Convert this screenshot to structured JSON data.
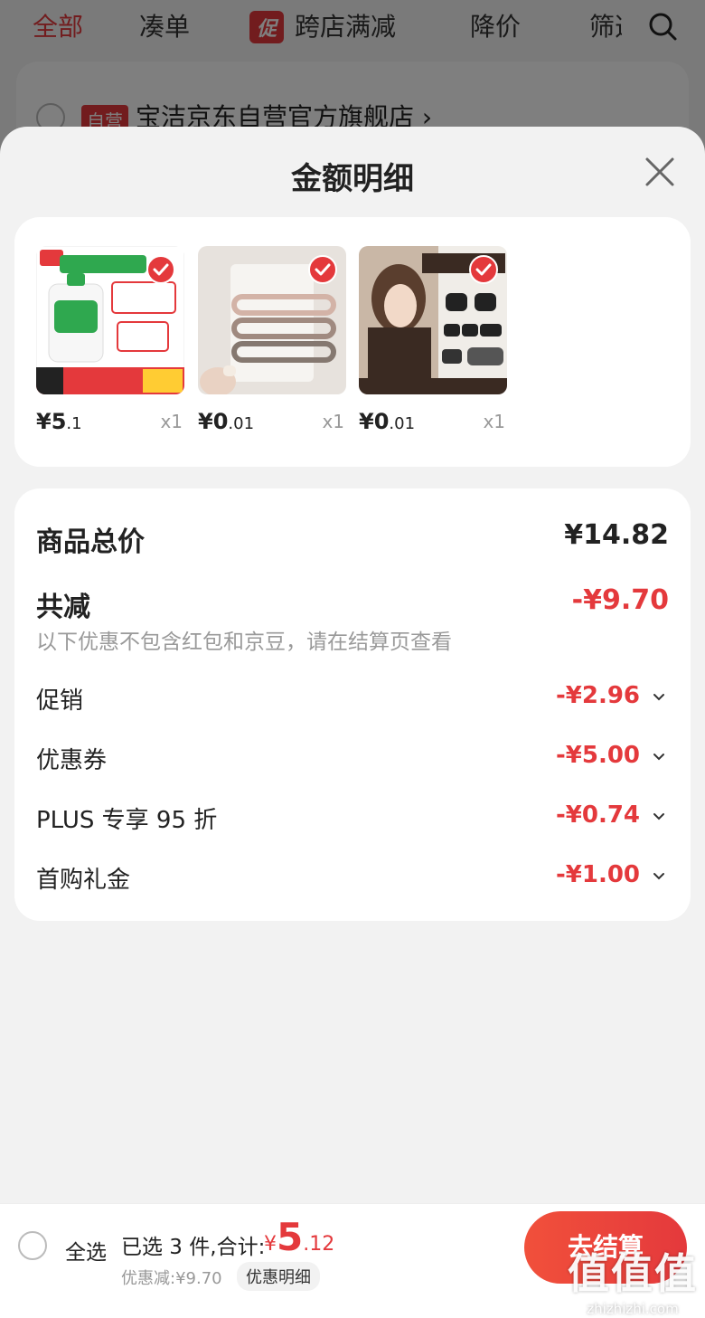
{
  "nav": {
    "tabs": [
      "全部",
      "凑单",
      "跨店满减",
      "降价",
      "筛选"
    ],
    "promo_badge": "促"
  },
  "store": {
    "self_badge": "自营",
    "name": "宝洁京东自营官方旗舰店 ›"
  },
  "sheet": {
    "title": "金额明细"
  },
  "products": [
    {
      "image": "laundry-detergent-product",
      "price_int": "¥5",
      "price_dec": ".1",
      "qty": "x1"
    },
    {
      "image": "hair-clip-product",
      "price_int": "¥0",
      "price_dec": ".01",
      "qty": "x1"
    },
    {
      "image": "hair-claw-product",
      "price_int": "¥0",
      "price_dec": ".01",
      "qty": "x1"
    }
  ],
  "detail": {
    "total_label": "商品总价",
    "total_value": "¥14.82",
    "reduce_label": "共减",
    "reduce_value": "-¥9.70",
    "note": "以下优惠不包含红包和京豆，请在结算页查看",
    "items": [
      {
        "label": "促销",
        "value": "-¥2.96"
      },
      {
        "label": "优惠券",
        "value": "-¥5.00"
      },
      {
        "label": "PLUS 专享 95 折",
        "value": "-¥0.74"
      },
      {
        "label": "首购礼金",
        "value": "-¥1.00"
      }
    ]
  },
  "bottom": {
    "select_all": "全选",
    "selected_text": "已选 3 件,合计:",
    "total_symbol": "¥",
    "total_int": "5",
    "total_dec": ".12",
    "discount_text": "优惠减:¥9.70",
    "detail_button": "优惠明细",
    "checkout_button": "去结算"
  },
  "watermark": {
    "logo": "值值值",
    "url": "zhizhizhi.com"
  },
  "colors": {
    "accent": "#e4393c",
    "background": "#f2f2f2",
    "card": "#ffffff"
  }
}
